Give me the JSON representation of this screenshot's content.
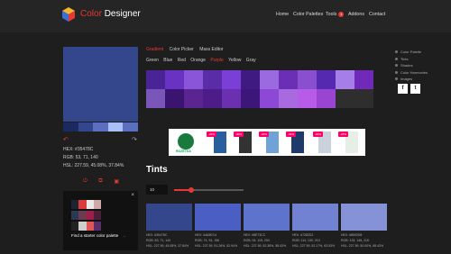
{
  "header": {
    "brand_part1": "Color",
    "brand_part2": "Designer",
    "nav": [
      "Home",
      "Color Palettes",
      "Tools",
      "Addons",
      "Contact"
    ],
    "tools_badge": "1"
  },
  "color": {
    "hex_line": "HEX: #35478C",
    "rgb_line": "RGB: 53, 71, 140",
    "hsl_line": "HSL: 227.59, 45.08%, 37.84%",
    "main_color": "#35478c",
    "shades": [
      "#1b2a5e",
      "#35478c",
      "#5a6fbf",
      "#a9bff7",
      "#5a6fbf"
    ]
  },
  "promo": {
    "close": "×",
    "cta": "Find a starter color palette",
    "cta_arrow": "→",
    "row1": [
      "#1b2430",
      "#d93a3a",
      "#e9e9e9",
      "#cfa8a8"
    ],
    "row2": [
      "#2a3a55",
      "#6e3a50",
      "#9b1f4a",
      "#4a1f3a"
    ],
    "row3": [
      "#222222",
      "#cfcfcf",
      "#e05555",
      "#5a2e6b"
    ]
  },
  "tabs": {
    "main": [
      "Gradient",
      "Color Picker",
      "Mass Editor"
    ],
    "active_main": 0,
    "colors": [
      "Green",
      "Blue",
      "Red",
      "Orange",
      "Purple",
      "Yellow",
      "Gray"
    ],
    "active_color": 4
  },
  "grid_colors": [
    "#4a2396",
    "#6a32c2",
    "#8a55d8",
    "#5a2ca8",
    "#7a3fd6",
    "#3f1a80",
    "#9b6ae0",
    "#6b2fb5",
    "#8a4ed0",
    "#562ab0",
    "#a67ee8",
    "#7029b8",
    "#7a56b8",
    "#3a1470",
    "#5a2590",
    "#4e1c88",
    "#6b30b0",
    "#3c1678",
    "#8e48d6",
    "#a96ae0",
    "#b85be8",
    "#9a45d2",
    "#2e2e2e",
    "#2e2e2e"
  ],
  "ad": {
    "logo_text": "ROZETKA",
    "tags": [
      "-20%",
      "-30%",
      "-20%",
      "-30%",
      "-20%",
      "-25%"
    ]
  },
  "tints": {
    "title": "Tints",
    "count": "10",
    "slider_fraction": 0.25,
    "items": [
      {
        "color": "#35478c",
        "hex": "HEX: #35478C",
        "rgb": "RGB: 53, 71, 140",
        "hsl": "HSL: 227.59, 45.08%, 37.84%"
      },
      {
        "color": "#4a5ec4",
        "hex": "HEX: #4A5EC4",
        "rgb": "RGB: 74, 94, 196",
        "hsl": "HSL: 227.59, 51.26%, 52.94%"
      },
      {
        "color": "#5e73cc",
        "hex": "HEX: #5E73CC",
        "rgb": "RGB: 94, 115, 204",
        "hsl": "HSL: 227.59, 52.38%, 58.43%"
      },
      {
        "color": "#7282d2",
        "hex": "HEX: #7282D2",
        "rgb": "RGB: 114, 130, 210",
        "hsl": "HSL: 227.59, 52.17%, 63.53%"
      },
      {
        "color": "#8592d8",
        "hex": "HEX: #8592D8",
        "rgb": "RGB: 133, 146, 216",
        "hsl": "HSL: 227.59, 50.00%, 68.43%"
      }
    ]
  },
  "side_list": [
    "Color Palette",
    "Tints",
    "Shades",
    "Color Harmonies",
    "Images"
  ],
  "social": [
    "f",
    "t"
  ]
}
